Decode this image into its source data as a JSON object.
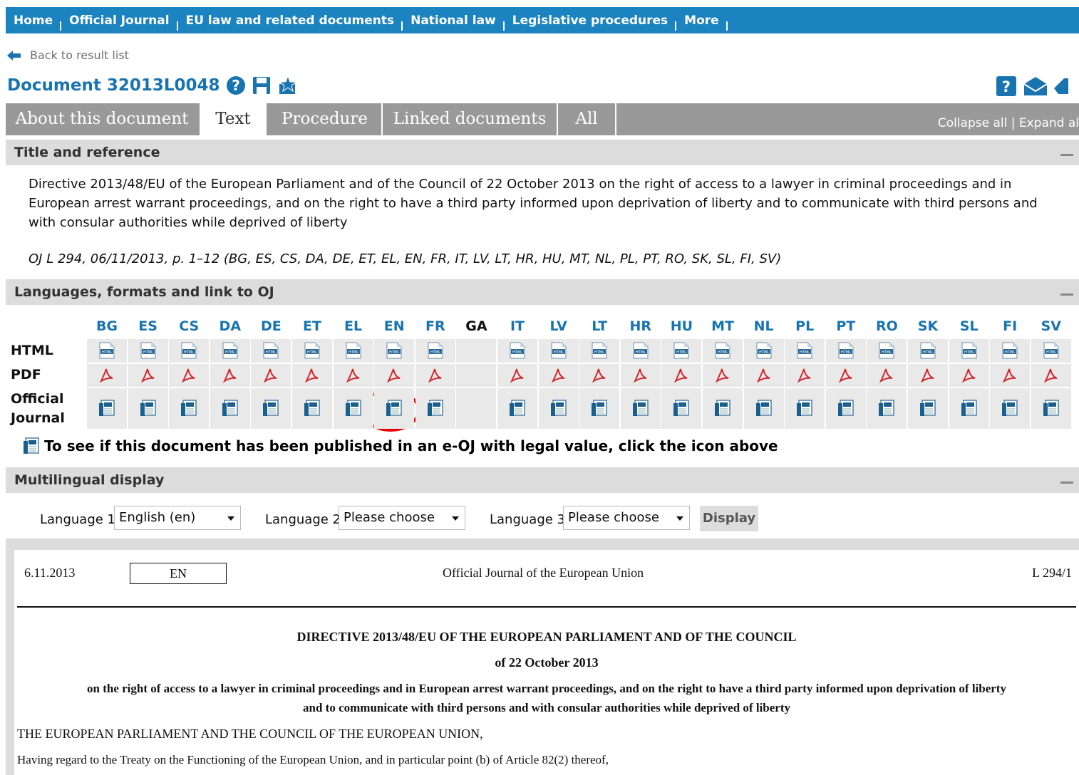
{
  "nav": {
    "items": [
      "Home",
      "Official Journal",
      "EU law and related documents",
      "National law",
      "Legislative procedures",
      "More"
    ]
  },
  "back_link": "Back to result list",
  "document": {
    "title": "Document 32013L0048"
  },
  "tabs": {
    "items": [
      "About this document",
      "Text",
      "Procedure",
      "Linked documents",
      "All"
    ],
    "active": "Text",
    "collapse_expand": "Collapse all | Expand al"
  },
  "sections": {
    "title_ref": "Title and reference",
    "languages": "Languages, formats and link to OJ",
    "multilingual": "Multilingual display"
  },
  "title_text": "Directive 2013/48/EU of the European Parliament and of the Council of 22 October 2013 on the right of access to a lawyer in criminal proceedings and in European arrest warrant proceedings, and on the right to have a third party informed upon deprivation of liberty and to communicate with third persons and with consular authorities while deprived of liberty",
  "oj_reference": "OJ L 294, 06/11/2013, p. 1–12 (BG, ES, CS, DA, DE, ET, EL, EN, FR, IT, LV, LT, HR, HU, MT, NL, PL, PT, RO, SK, SL, FI, SV)",
  "languages": {
    "codes": [
      "BG",
      "ES",
      "CS",
      "DA",
      "DE",
      "ET",
      "EL",
      "EN",
      "FR",
      "GA",
      "IT",
      "LV",
      "LT",
      "HR",
      "HU",
      "MT",
      "NL",
      "PL",
      "PT",
      "RO",
      "SK",
      "SL",
      "FI",
      "SV"
    ],
    "unavailable": [
      "GA"
    ],
    "row_labels": {
      "html": "HTML",
      "pdf": "PDF",
      "oj_line1": "Official",
      "oj_line2": "Journal"
    },
    "highlighted": "EN"
  },
  "eoj_note": "To see if this document has been published in an e-OJ with legal value, click the icon above",
  "multilingual": {
    "language1_label": "Language 1",
    "language1_value": "English (en)",
    "language2_label": "Language 2",
    "language2_value": "Please choose",
    "language3_label": "Language 3",
    "language3_value": "Please choose",
    "display_button": "Display"
  },
  "oj_document": {
    "date": "6.11.2013",
    "lang_box": "EN",
    "journal_name": "Official Journal of the European Union",
    "page_ref": "L 294/1",
    "heading": "DIRECTIVE 2013/48/EU OF THE EUROPEAN PARLIAMENT AND OF THE COUNCIL",
    "date_line": "of 22 October 2013",
    "subject_line1": "on the right of access to a lawyer in criminal proceedings and in European arrest warrant proceedings, and on the right to have a third party informed upon deprivation of liberty",
    "subject_line2": "and to communicate with third persons and with consular authorities while deprived of liberty",
    "para1": "THE EUROPEAN PARLIAMENT AND THE COUNCIL OF THE EUROPEAN UNION,",
    "para2": "Having regard to the Treaty on the Functioning of the European Union, and in particular point (b) of Article 82(2) thereof,"
  },
  "colors": {
    "nav_bg": "#1b83bf",
    "title_blue": "#1874b0",
    "tab_bg": "#999999",
    "section_bg": "#dcdcdc",
    "highlight_circle": "#e00000"
  }
}
